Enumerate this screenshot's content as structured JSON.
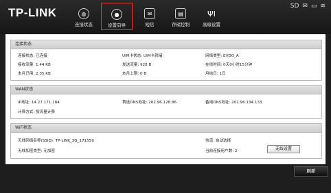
{
  "brand": {
    "logo": "TP-LINK"
  },
  "nav": [
    {
      "label": "连接状态",
      "icon": "globe-icon"
    },
    {
      "label": "设置向导",
      "icon": "compass-icon"
    },
    {
      "label": "短信",
      "icon": "envelope-icon"
    },
    {
      "label": "存储控制",
      "icon": "sd-card-icon"
    },
    {
      "label": "高级设置",
      "icon": "tools-icon"
    }
  ],
  "status_bar": {
    "sd": "SD",
    "mail": "✉",
    "battery": "▭",
    "wifi": "≋"
  },
  "connection": {
    "title": "连接状态",
    "rows": [
      [
        "连接状态: 已连接",
        "UIM卡状态: UIM卡就绪",
        "网络类型: EVDO_A"
      ],
      [
        "接收流量: 1.44 KB",
        "发送流量: 928 B",
        "在线时间: 0天0小时15分钟"
      ],
      [
        "本月已用: 2.35 KB",
        "本月上限: 0 B",
        "月结日: 1日"
      ]
    ]
  },
  "wan": {
    "title": "WAN状态",
    "ip": "IP地址: 14.27.171.184",
    "dns1": "首选DNS地址: 202.96.128.86",
    "dns2": "备用DNS地址: 202.96.134.133",
    "billing": "计费方式: 按流量计费"
  },
  "wifi": {
    "title": "WiFi状态",
    "ssid": "无线网络名称(SSID): TP-LINK_3G_171559",
    "channel": "信道: 自动选择",
    "encryption": "无线加密类型: 无加密",
    "users": "当前连接用户数: 2",
    "settings_button": "无线设置"
  },
  "refresh_button": "刷新"
}
